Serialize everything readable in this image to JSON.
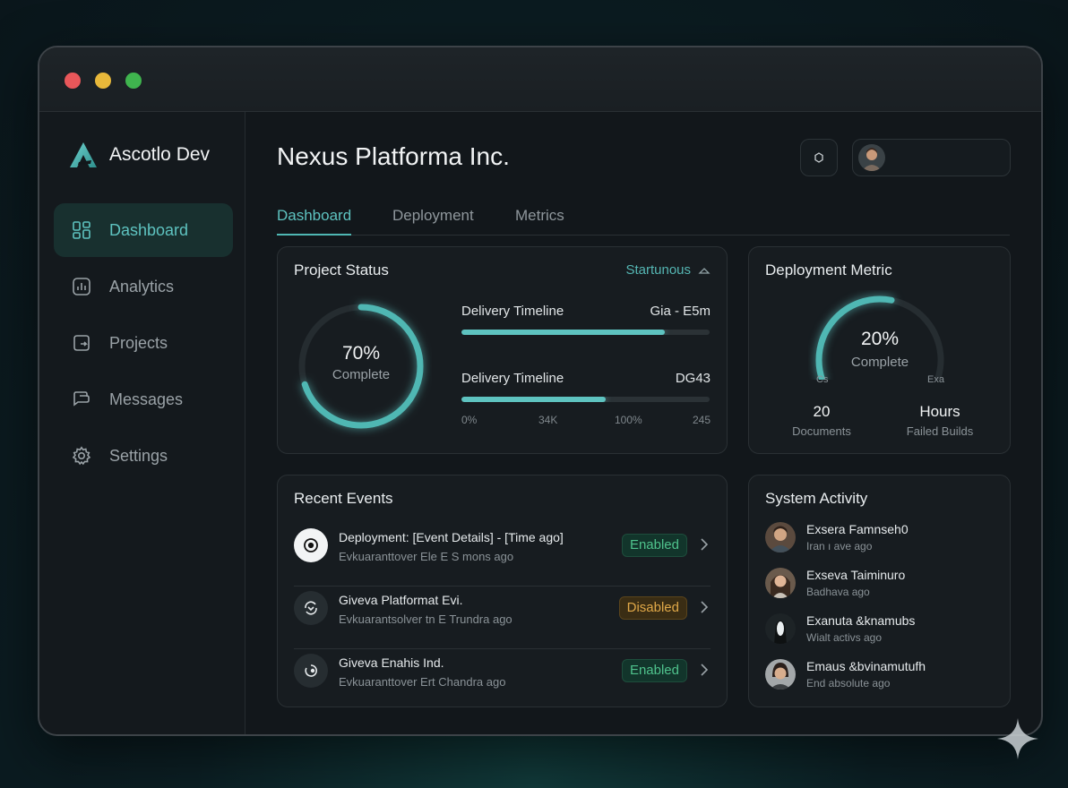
{
  "window": {
    "buttons": [
      "close",
      "minimize",
      "maximize"
    ]
  },
  "sidebar": {
    "brand": "Ascotlo Dev",
    "items": [
      {
        "label": "Dashboard",
        "icon": "grid-icon",
        "active": true
      },
      {
        "label": "Analytics",
        "icon": "chart-icon",
        "active": false
      },
      {
        "label": "Projects",
        "icon": "folder-icon",
        "active": false
      },
      {
        "label": "Messages",
        "icon": "message-icon",
        "active": false
      },
      {
        "label": "Settings",
        "icon": "gear-icon",
        "active": false
      }
    ]
  },
  "header": {
    "title": "Nexus Platforma Inc."
  },
  "tabs": [
    {
      "label": "Dashboard",
      "active": true
    },
    {
      "label": "Deployment",
      "active": false
    },
    {
      "label": "Metrics",
      "active": false
    }
  ],
  "project_status": {
    "title": "Project Status",
    "status_link": "Startunous",
    "ring_value": "70%",
    "ring_fraction": 0.7,
    "ring_caption": "Complete",
    "bars": [
      {
        "label": "Delivery Timeline",
        "value": "Gia - E5m",
        "fraction": 0.82
      },
      {
        "label": "Delivery Timeline",
        "value": "DG43",
        "fraction": 0.58
      }
    ],
    "ticks": [
      "0%",
      "34K",
      "100%",
      "245"
    ]
  },
  "deployment_metric": {
    "title": "Deployment Metric",
    "gauge_value": "20%",
    "gauge_fraction": 0.55,
    "gauge_caption": "Complete",
    "gauge_min_label": "Cs",
    "gauge_max_label": "Exa",
    "stats": [
      {
        "value": "20",
        "label": "Documents"
      },
      {
        "value": "Hours",
        "label": "Failed Builds"
      }
    ]
  },
  "recent_events": {
    "title": "Recent Events",
    "items": [
      {
        "title": "Deployment: [Event Details] - [Time ago]",
        "sub": "Evkuaranttover Ele E S mons ago",
        "status": "Enabled"
      },
      {
        "title": "Giveva Platformat Evi.",
        "sub": "Evkuarantsolver tn E Trundra ago",
        "status": "Disabled"
      },
      {
        "title": "Giveva Enahis Ind.",
        "sub": "Evkuaranttover Ert Chandra ago",
        "status": "Enabled"
      }
    ]
  },
  "system_activity": {
    "title": "System Activity",
    "items": [
      {
        "name": "Exsera Famnseh0",
        "sub": "Iran ı ave ago"
      },
      {
        "name": "Exseva Taiminuro",
        "sub": "Badhava ago"
      },
      {
        "name": "Exanuta &knamubs",
        "sub": "Wialt activs ago"
      },
      {
        "name": "Emaus &bvinamutufh",
        "sub": "End absolute ago"
      }
    ]
  },
  "colors": {
    "accent": "#5ec3c0",
    "enabled": "#4fc28c",
    "disabled": "#e0a848",
    "background": "#12171b"
  }
}
